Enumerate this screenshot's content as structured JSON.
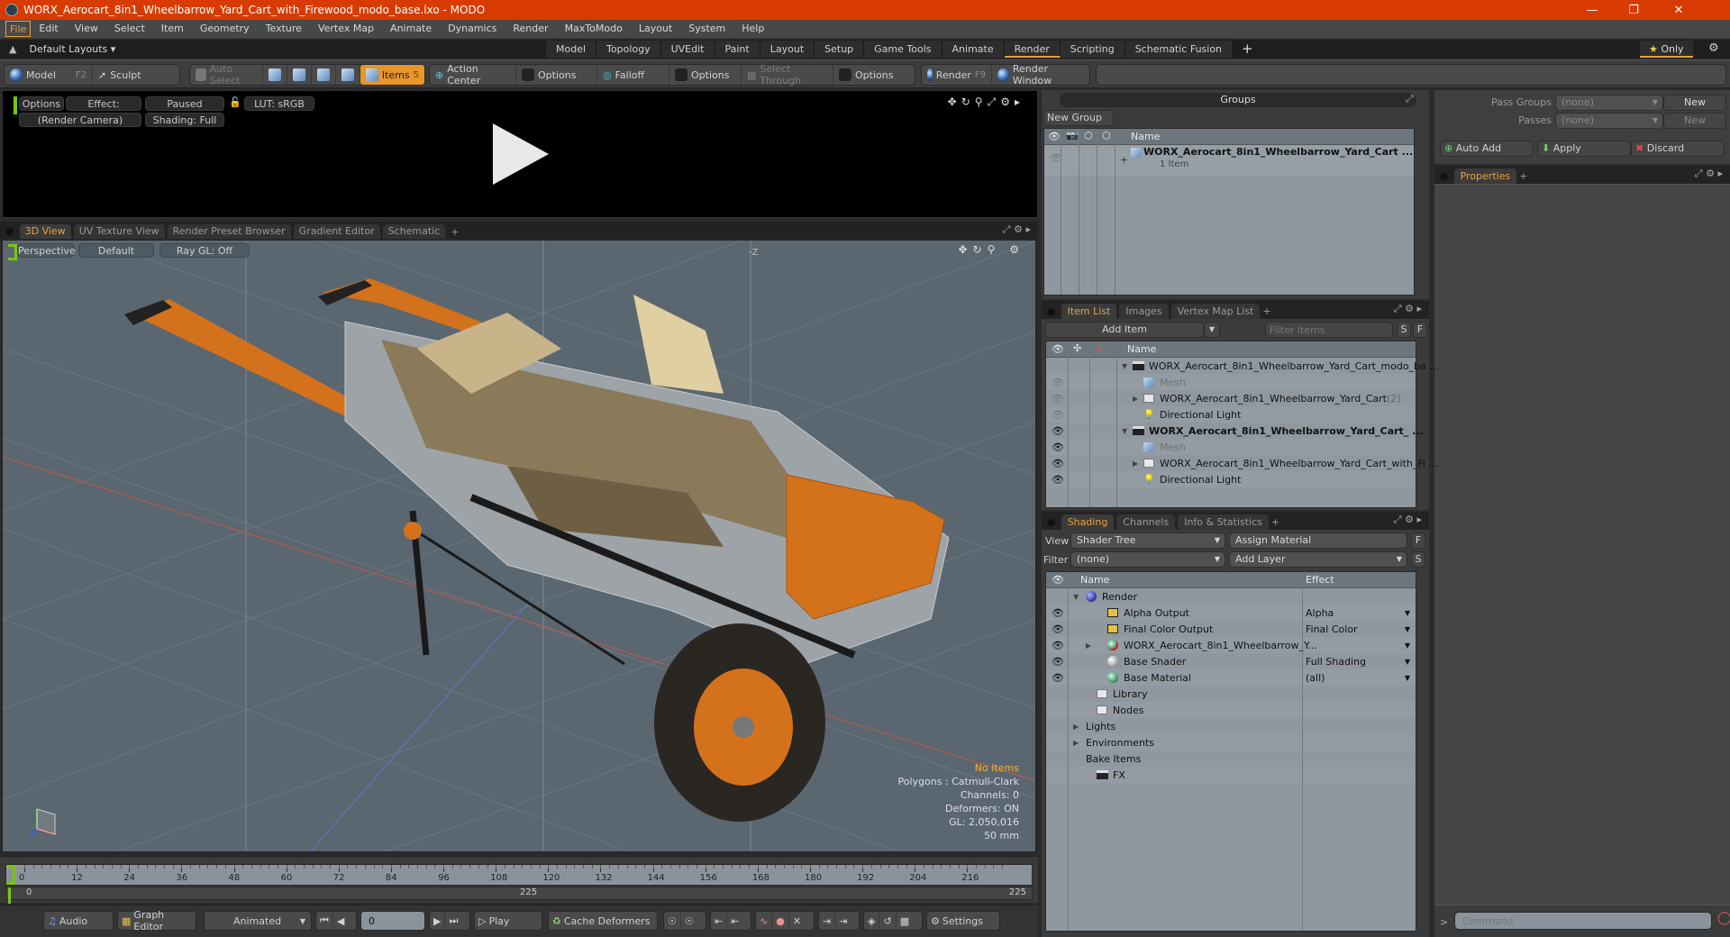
{
  "window": {
    "title": "WORX_Aerocart_8in1_Wheelbarrow_Yard_Cart_with_Firewood_modo_base.lxo - MODO",
    "controls": [
      "minimize",
      "restore",
      "close"
    ]
  },
  "menubar": {
    "items": [
      "File",
      "Edit",
      "View",
      "Select",
      "Item",
      "Geometry",
      "Texture",
      "Vertex Map",
      "Animate",
      "Dynamics",
      "Render",
      "MaxToModo",
      "Layout",
      "System",
      "Help"
    ]
  },
  "layoutbar": {
    "default_layouts": "Default Layouts",
    "tabs": [
      "Model",
      "Topology",
      "UVEdit",
      "Paint",
      "Layout",
      "Setup",
      "Game Tools",
      "Animate",
      "Render",
      "Scripting",
      "Schematic Fusion"
    ],
    "active_tab": "Render",
    "add_tab": "+",
    "only_label": "Only"
  },
  "toolbar": {
    "model": "Model",
    "model_key": "F2",
    "sculpt": "Sculpt",
    "auto_select": "Auto Select",
    "items": "Items",
    "items_count": "5",
    "action_center": "Action Center",
    "options1": "Options",
    "falloff": "Falloff",
    "options2": "Options",
    "select_through": "Select Through",
    "options3": "Options",
    "render": "Render",
    "render_key": "F9",
    "render_window": "Render Window"
  },
  "render_view": {
    "options": "Options",
    "effect": "Effect: (Shadi...",
    "paused": "Paused",
    "lut": "LUT: sRGB",
    "camera": "(Render Camera)",
    "shading": "Shading: Full"
  },
  "viewport_tabs": {
    "tabs": [
      "3D View",
      "UV Texture View",
      "Render Preset Browser",
      "Gradient Editor",
      "Schematic"
    ],
    "active": "3D View",
    "add": "+"
  },
  "viewport": {
    "perspective": "Perspective",
    "default": "Default",
    "raygl": "Ray GL: Off",
    "axis_label": "-Z",
    "info": {
      "no_items": "No Items",
      "polygons": "Polygons : Catmull-Clark",
      "channels": "Channels: 0",
      "deformers": "Deformers: ON",
      "gl": "GL: 2,050,016",
      "lens": "50 mm"
    },
    "info_highlight_color": "#f0b43a"
  },
  "timeline": {
    "ticks": [
      "0",
      "12",
      "24",
      "36",
      "48",
      "60",
      "72",
      "84",
      "96",
      "108",
      "120",
      "132",
      "144",
      "156",
      "168",
      "180",
      "192",
      "204",
      "216"
    ],
    "range_start": "0",
    "range_mid": "225",
    "range_end": "225"
  },
  "transport": {
    "audio": "Audio",
    "graph_editor": "Graph Editor",
    "animated": "Animated",
    "frame": "0",
    "play": "Play",
    "cache_deformers": "Cache Deformers",
    "settings": "Settings"
  },
  "groups_panel": {
    "title": "Groups",
    "new_group": "New Group",
    "column_name": "Name",
    "rows": [
      {
        "name": "WORX_Aerocart_8in1_Wheelbarrow_Yard_Cart ...",
        "sub": "1 Item"
      }
    ]
  },
  "pass_panel": {
    "pass_groups_label": "Pass Groups",
    "pass_groups_value": "(none)",
    "passes_label": "Passes",
    "passes_value": "(none)",
    "new1": "New",
    "new2": "New",
    "auto_add": "Auto Add",
    "apply": "Apply",
    "discard": "Discard"
  },
  "properties_panel": {
    "tab": "Properties",
    "add": "+"
  },
  "item_list": {
    "tabs": [
      "Item List",
      "Images",
      "Vertex Map List"
    ],
    "active": "Item List",
    "add_item": "Add Item",
    "filter_placeholder": "Filter Items",
    "s": "S",
    "f": "F",
    "column_name": "Name",
    "rows": [
      {
        "name": "WORX_Aerocart_8in1_Wheelbarrow_Yard_Cart_modo_ba ...",
        "type": "scene",
        "indent": 0,
        "expand": "open",
        "bold": false,
        "eye": false
      },
      {
        "name": "Mesh",
        "type": "mesh",
        "indent": 1,
        "expand": "",
        "dim": true,
        "eye": true,
        "eyedim": true
      },
      {
        "name": "WORX_Aerocart_8in1_Wheelbarrow_Yard_Cart",
        "count": "(2)",
        "type": "folder",
        "indent": 1,
        "expand": "closed",
        "eye": true,
        "eyedim": true
      },
      {
        "name": "Directional Light",
        "type": "light",
        "indent": 1,
        "expand": "",
        "eye": true,
        "eyedim": true
      },
      {
        "name": "WORX_Aerocart_8in1_Wheelbarrow_Yard_Cart_  ...",
        "type": "scene",
        "indent": 0,
        "expand": "open",
        "bold": true,
        "eye": true
      },
      {
        "name": "Mesh",
        "type": "mesh",
        "indent": 1,
        "expand": "",
        "dim": true,
        "eye": true
      },
      {
        "name": "WORX_Aerocart_8in1_Wheelbarrow_Yard_Cart_with_Fi ...",
        "type": "folder",
        "indent": 1,
        "expand": "closed",
        "eye": true
      },
      {
        "name": "Directional Light",
        "type": "light",
        "indent": 1,
        "expand": "",
        "eye": true
      }
    ]
  },
  "shading": {
    "tabs": [
      "Shading",
      "Channels",
      "Info & Statistics"
    ],
    "active": "Shading",
    "view_label": "View",
    "view_value": "Shader Tree",
    "assign_material": "Assign Material",
    "f": "F",
    "filter_label": "Filter",
    "filter_value": "(none)",
    "add_layer": "Add Layer",
    "s": "S",
    "col_name": "Name",
    "col_effect": "Effect",
    "rows": [
      {
        "name": "Render",
        "icon": "render",
        "indent": 0,
        "expand": "open",
        "effect": "",
        "eye": false
      },
      {
        "name": "Alpha Output",
        "icon": "image",
        "indent": 1,
        "effect": "Alpha",
        "eye": true,
        "dd": true
      },
      {
        "name": "Final Color Output",
        "icon": "image",
        "indent": 1,
        "effect": "Final Color",
        "eye": true,
        "dd": true
      },
      {
        "name": "WORX_Aerocart_8in1_Wheelbarrow_Y...",
        "icon": "material-group",
        "indent": 1,
        "expand": "closed",
        "effect": "",
        "eye": true,
        "dd": true
      },
      {
        "name": "Base Shader",
        "icon": "shader",
        "indent": 1,
        "effect": "Full Shading",
        "eye": true,
        "dd": true
      },
      {
        "name": "Base Material",
        "icon": "material",
        "indent": 1,
        "effect": "(all)",
        "eye": true,
        "dd": true
      },
      {
        "name": "Library",
        "icon": "folder",
        "indent": 0.5,
        "effect": "",
        "eye": false
      },
      {
        "name": "Nodes",
        "icon": "folder",
        "indent": 0.5,
        "effect": "",
        "eye": false
      },
      {
        "name": "Lights",
        "icon": "",
        "indent": 0,
        "expand": "closed",
        "effect": "",
        "eye": false
      },
      {
        "name": "Environments",
        "icon": "",
        "indent": 0,
        "expand": "closed",
        "effect": "",
        "eye": false
      },
      {
        "name": "Bake Items",
        "icon": "",
        "indent": 0,
        "effect": "",
        "eye": false
      },
      {
        "name": "FX",
        "icon": "fx",
        "indent": 0.5,
        "effect": "",
        "eye": false
      }
    ]
  },
  "command": {
    "prompt": ">",
    "placeholder": "Command"
  },
  "colors": {
    "title_bar": "#d83b01",
    "accent": "#e8a23c",
    "viewport_bg": "#5b6770",
    "list_bg": "#8f989f"
  }
}
